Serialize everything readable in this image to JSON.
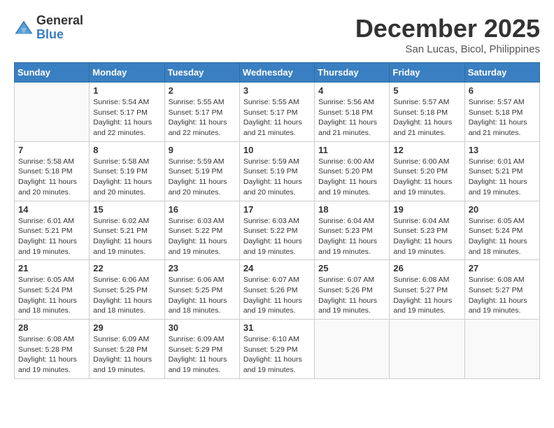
{
  "header": {
    "logo_general": "General",
    "logo_blue": "Blue",
    "month_title": "December 2025",
    "subtitle": "San Lucas, Bicol, Philippines"
  },
  "days_of_week": [
    "Sunday",
    "Monday",
    "Tuesday",
    "Wednesday",
    "Thursday",
    "Friday",
    "Saturday"
  ],
  "weeks": [
    [
      {
        "day": "",
        "info": ""
      },
      {
        "day": "1",
        "info": "Sunrise: 5:54 AM\nSunset: 5:17 PM\nDaylight: 11 hours\nand 22 minutes."
      },
      {
        "day": "2",
        "info": "Sunrise: 5:55 AM\nSunset: 5:17 PM\nDaylight: 11 hours\nand 22 minutes."
      },
      {
        "day": "3",
        "info": "Sunrise: 5:55 AM\nSunset: 5:17 PM\nDaylight: 11 hours\nand 21 minutes."
      },
      {
        "day": "4",
        "info": "Sunrise: 5:56 AM\nSunset: 5:18 PM\nDaylight: 11 hours\nand 21 minutes."
      },
      {
        "day": "5",
        "info": "Sunrise: 5:57 AM\nSunset: 5:18 PM\nDaylight: 11 hours\nand 21 minutes."
      },
      {
        "day": "6",
        "info": "Sunrise: 5:57 AM\nSunset: 5:18 PM\nDaylight: 11 hours\nand 21 minutes."
      }
    ],
    [
      {
        "day": "7",
        "info": "Sunrise: 5:58 AM\nSunset: 5:18 PM\nDaylight: 11 hours\nand 20 minutes."
      },
      {
        "day": "8",
        "info": "Sunrise: 5:58 AM\nSunset: 5:19 PM\nDaylight: 11 hours\nand 20 minutes."
      },
      {
        "day": "9",
        "info": "Sunrise: 5:59 AM\nSunset: 5:19 PM\nDaylight: 11 hours\nand 20 minutes."
      },
      {
        "day": "10",
        "info": "Sunrise: 5:59 AM\nSunset: 5:19 PM\nDaylight: 11 hours\nand 20 minutes."
      },
      {
        "day": "11",
        "info": "Sunrise: 6:00 AM\nSunset: 5:20 PM\nDaylight: 11 hours\nand 19 minutes."
      },
      {
        "day": "12",
        "info": "Sunrise: 6:00 AM\nSunset: 5:20 PM\nDaylight: 11 hours\nand 19 minutes."
      },
      {
        "day": "13",
        "info": "Sunrise: 6:01 AM\nSunset: 5:21 PM\nDaylight: 11 hours\nand 19 minutes."
      }
    ],
    [
      {
        "day": "14",
        "info": "Sunrise: 6:01 AM\nSunset: 5:21 PM\nDaylight: 11 hours\nand 19 minutes."
      },
      {
        "day": "15",
        "info": "Sunrise: 6:02 AM\nSunset: 5:21 PM\nDaylight: 11 hours\nand 19 minutes."
      },
      {
        "day": "16",
        "info": "Sunrise: 6:03 AM\nSunset: 5:22 PM\nDaylight: 11 hours\nand 19 minutes."
      },
      {
        "day": "17",
        "info": "Sunrise: 6:03 AM\nSunset: 5:22 PM\nDaylight: 11 hours\nand 19 minutes."
      },
      {
        "day": "18",
        "info": "Sunrise: 6:04 AM\nSunset: 5:23 PM\nDaylight: 11 hours\nand 19 minutes."
      },
      {
        "day": "19",
        "info": "Sunrise: 6:04 AM\nSunset: 5:23 PM\nDaylight: 11 hours\nand 19 minutes."
      },
      {
        "day": "20",
        "info": "Sunrise: 6:05 AM\nSunset: 5:24 PM\nDaylight: 11 hours\nand 18 minutes."
      }
    ],
    [
      {
        "day": "21",
        "info": "Sunrise: 6:05 AM\nSunset: 5:24 PM\nDaylight: 11 hours\nand 18 minutes."
      },
      {
        "day": "22",
        "info": "Sunrise: 6:06 AM\nSunset: 5:25 PM\nDaylight: 11 hours\nand 18 minutes."
      },
      {
        "day": "23",
        "info": "Sunrise: 6:06 AM\nSunset: 5:25 PM\nDaylight: 11 hours\nand 18 minutes."
      },
      {
        "day": "24",
        "info": "Sunrise: 6:07 AM\nSunset: 5:26 PM\nDaylight: 11 hours\nand 19 minutes."
      },
      {
        "day": "25",
        "info": "Sunrise: 6:07 AM\nSunset: 5:26 PM\nDaylight: 11 hours\nand 19 minutes."
      },
      {
        "day": "26",
        "info": "Sunrise: 6:08 AM\nSunset: 5:27 PM\nDaylight: 11 hours\nand 19 minutes."
      },
      {
        "day": "27",
        "info": "Sunrise: 6:08 AM\nSunset: 5:27 PM\nDaylight: 11 hours\nand 19 minutes."
      }
    ],
    [
      {
        "day": "28",
        "info": "Sunrise: 6:08 AM\nSunset: 5:28 PM\nDaylight: 11 hours\nand 19 minutes."
      },
      {
        "day": "29",
        "info": "Sunrise: 6:09 AM\nSunset: 5:28 PM\nDaylight: 11 hours\nand 19 minutes."
      },
      {
        "day": "30",
        "info": "Sunrise: 6:09 AM\nSunset: 5:29 PM\nDaylight: 11 hours\nand 19 minutes."
      },
      {
        "day": "31",
        "info": "Sunrise: 6:10 AM\nSunset: 5:29 PM\nDaylight: 11 hours\nand 19 minutes."
      },
      {
        "day": "",
        "info": ""
      },
      {
        "day": "",
        "info": ""
      },
      {
        "day": "",
        "info": ""
      }
    ]
  ]
}
